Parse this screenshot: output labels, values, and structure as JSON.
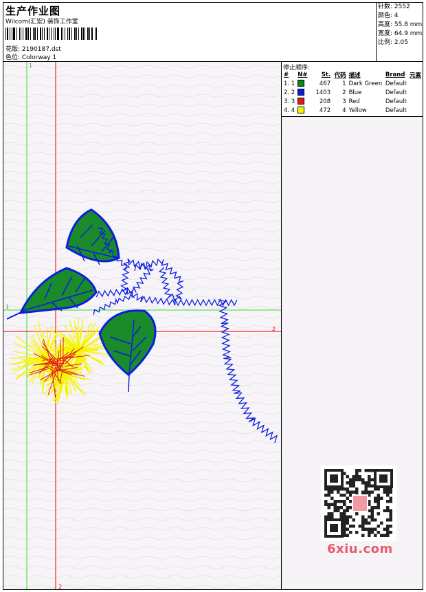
{
  "header": {
    "title": "生产作业图",
    "company": "Wilcom(汇宏) 装饰工作室",
    "design_label": "花版: 2190187.dst",
    "color_label": "色位: Colorway 1"
  },
  "stats": {
    "stitches": "针数: 2552",
    "colors": "颜色: 4",
    "height": "高度: 55.8 mm",
    "width": "宽度: 64.9 mm",
    "ratio": "比例: 2.05"
  },
  "legend": {
    "stop_label": "停止顺序:",
    "headers": [
      "#",
      "N#",
      "St.",
      "代码",
      "描述",
      "Brand",
      "元素"
    ],
    "rows": [
      {
        "index": "1. 1",
        "color": "#008a1a",
        "stitches": "467",
        "code": "1",
        "desc": "Dark Green",
        "brand": "Default"
      },
      {
        "index": "2. 2",
        "color": "#0a1ee0",
        "stitches": "1403",
        "code": "2",
        "desc": "Blue",
        "brand": "Default"
      },
      {
        "index": "3. 3",
        "color": "#e01a1a",
        "stitches": "208",
        "code": "3",
        "desc": "Red",
        "brand": "Default"
      },
      {
        "index": "4. 4",
        "color": "#f5f500",
        "stitches": "472",
        "code": "4",
        "desc": "Yellow",
        "brand": "Default"
      }
    ]
  },
  "axes": {
    "green_v": "1",
    "green_h": "1",
    "red_h": "2",
    "red_v": "2"
  },
  "watermark": "6xiu.com",
  "colors": {
    "green": "#008a1a",
    "blue": "#0a1ee0",
    "red": "#e01a1a",
    "yellow": "#f5f500",
    "guide_green": "#33dd33",
    "guide_red": "#ee0000"
  }
}
